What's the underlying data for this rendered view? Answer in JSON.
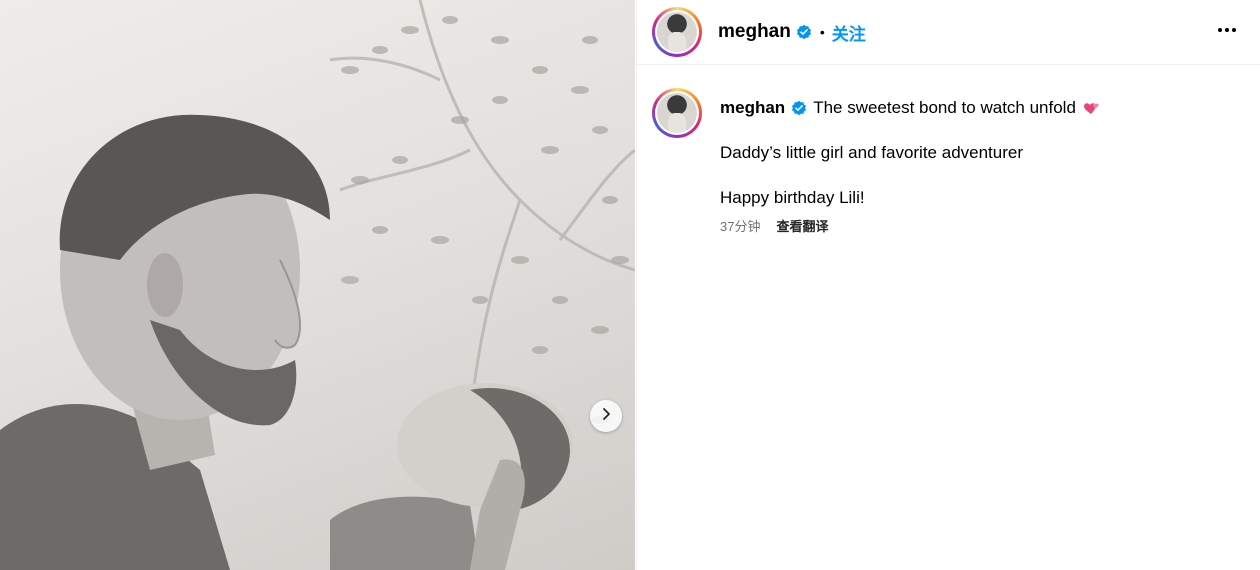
{
  "post": {
    "image": {
      "description_icon": "photo",
      "next_icon": "chevron-right-icon"
    },
    "header": {
      "username": "meghan",
      "verified_icon": "verified-badge-icon",
      "separator": "•",
      "follow_label": "关注",
      "more_icon": "more-options-icon"
    },
    "caption": {
      "username": "meghan",
      "line1": "The sweetest bond to watch unfold",
      "emoji_icon": "two-hearts-icon",
      "line2": "Daddy’s little girl and favorite adventurer",
      "line3": "Happy birthday Lili!",
      "time": "37分钟",
      "translate_label": "查看翻译"
    },
    "colors": {
      "accent": "#0095f6",
      "verified": "#0095f6",
      "muted": "#737373"
    }
  }
}
